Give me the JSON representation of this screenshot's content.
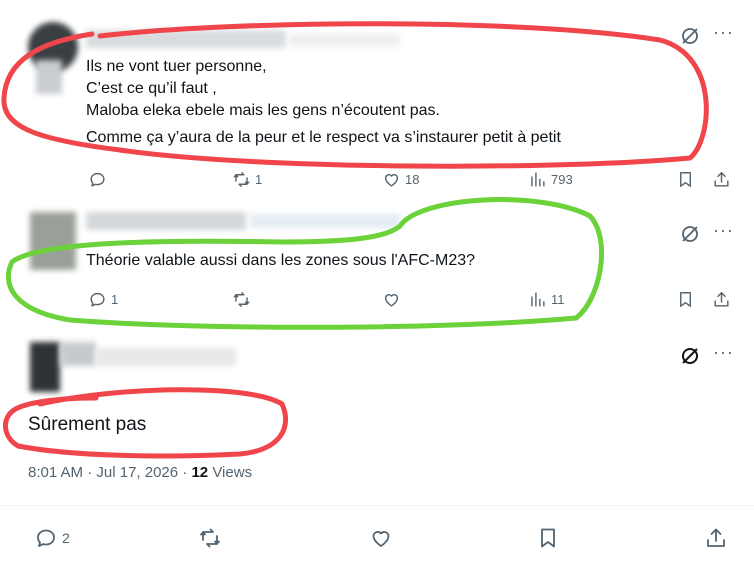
{
  "reply1": {
    "lines": [
      "Ils ne vont tuer personne,",
      "C’est ce qu’il faut ,",
      "Maloba eleka ebele mais les gens n’écoutent pas.",
      "Comme ça y’aura de la peur et le respect va s’instaurer petit à petit"
    ],
    "retweets": "1",
    "likes": "18",
    "views": "793"
  },
  "reply2": {
    "text": "Théorie valable aussi dans les zones sous l'AFC-M23?",
    "replies": "1",
    "views": "11"
  },
  "main": {
    "text": "Sûrement pas",
    "time": "8:01 AM",
    "sep1": "·",
    "date": "Jul 17, 2026",
    "sep2": "·",
    "views_count": "12",
    "views_label": "Views",
    "replies": "2"
  },
  "more_glyph": "···",
  "annotations": {
    "red": "#f0454b",
    "green": "#6bd23a"
  }
}
